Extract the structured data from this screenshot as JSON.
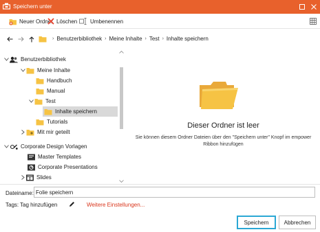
{
  "window": {
    "title": "Speichern unter",
    "controls": [
      "minimize",
      "close"
    ]
  },
  "toolbar": {
    "new_folder_label": "Neuer Ordner",
    "delete_label": "Löschen",
    "rename_label": "Umbenennen",
    "view_icon": "view-mode-icon"
  },
  "address": {
    "breadcrumb": [
      "Benutzerbibliothek",
      "Meine Inhalte",
      "Test",
      "Inhalte speichern"
    ]
  },
  "tree": {
    "items": [
      {
        "label": "Benutzerbibliothek",
        "icon": "users-icon",
        "expanded": true
      },
      {
        "label": "Meine Inhalte",
        "icon": "folder-icon",
        "expanded": true
      },
      {
        "label": "Handbuch",
        "icon": "folder-icon"
      },
      {
        "label": "Manual",
        "icon": "folder-icon"
      },
      {
        "label": "Test",
        "icon": "folder-icon",
        "expanded": true
      },
      {
        "label": "Inhalte speichern",
        "icon": "folder-icon",
        "selected": true
      },
      {
        "label": "Tutorials",
        "icon": "folder-icon"
      },
      {
        "label": "Mit mir geteilt",
        "icon": "shared-folder-icon",
        "expanded": false
      },
      {
        "label": "Corporate Design Vorlagen",
        "icon": "corporate-icon",
        "expanded": true
      },
      {
        "label": "Master Templates",
        "icon": "master-templates-icon"
      },
      {
        "label": "Corporate Presentations",
        "icon": "presentations-icon"
      },
      {
        "label": "Slides",
        "icon": "slides-icon",
        "expanded": false
      }
    ]
  },
  "empty_state": {
    "title": "Dieser Ordner ist leer",
    "description_line1": "Sie können diesem Ordner Dateien über den \"Speichern unter\" Knopf im empower",
    "description_line2": "Ribbon hinzufügen"
  },
  "form": {
    "filename_label": "Dateiname:",
    "filename_value": "Folie speichern",
    "tags_label": "Tags:",
    "tags_add": "Tag hinzufügen",
    "more_settings": "Weitere Einstellungen..."
  },
  "buttons": {
    "save": "Speichern",
    "cancel": "Abbrechen"
  },
  "colors": {
    "accent": "#e8612c",
    "focus": "#2aa7d4",
    "folder": "#f6c344",
    "link": "#d9361c"
  }
}
